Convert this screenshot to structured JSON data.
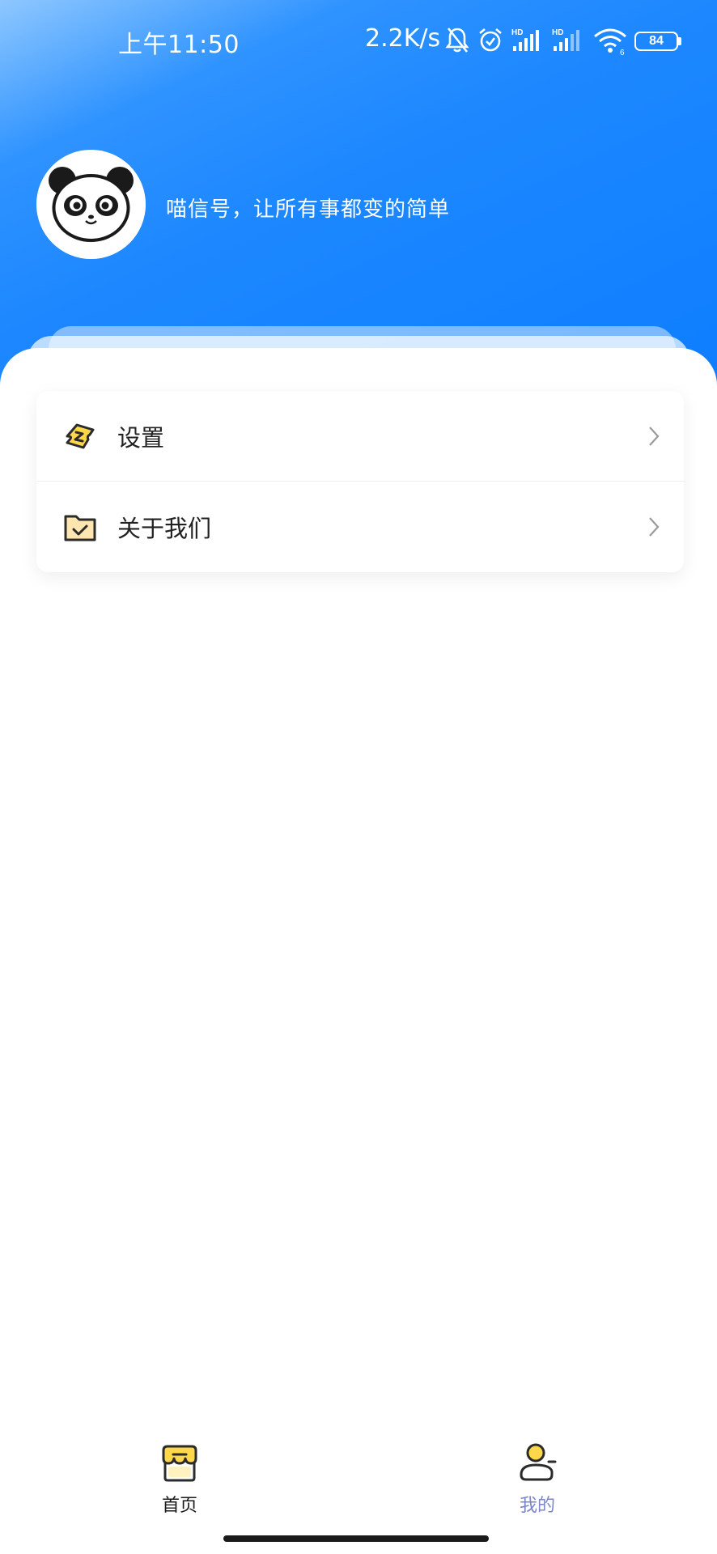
{
  "status_bar": {
    "time": "上午11:50",
    "network_speed": "2.2K/s",
    "battery_level": "84",
    "icons": [
      "mute-bell-icon",
      "alarm-icon",
      "signal-hd-icon",
      "signal-hd-icon",
      "wifi-icon",
      "battery-icon"
    ]
  },
  "profile": {
    "avatar": "panda-avatar",
    "slogan": "喵信号，让所有事都变的简单"
  },
  "menu": {
    "items": [
      {
        "label": "设置",
        "icon": "ticket-settings-icon"
      },
      {
        "label": "关于我们",
        "icon": "folder-check-icon"
      }
    ]
  },
  "bottom_nav": {
    "tabs": [
      {
        "label": "首页",
        "icon": "shop-icon",
        "active": false
      },
      {
        "label": "我的",
        "icon": "user-icon",
        "active": true
      }
    ]
  },
  "colors": {
    "header_blue": "#0d7dff",
    "active_tab_text": "#7a86c8",
    "accent_yellow": "#ffd84a"
  }
}
